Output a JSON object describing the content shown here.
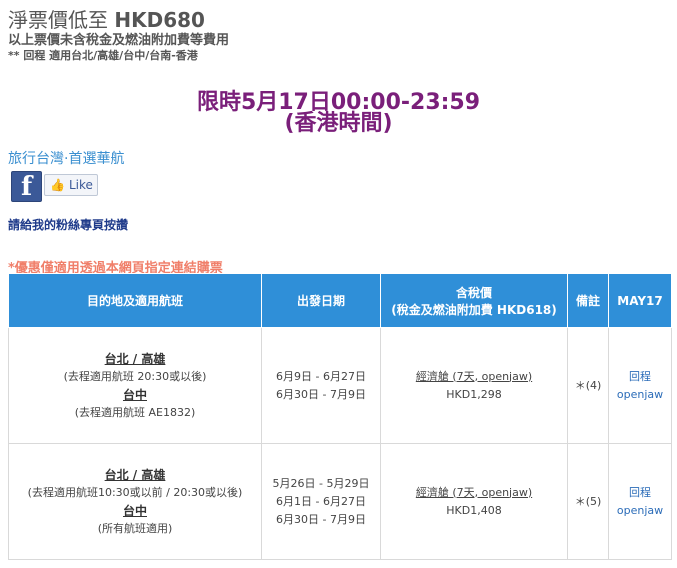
{
  "header": {
    "title_prefix": "淨票價低至 ",
    "title_price": "HKD680",
    "subtitle": "以上票價未含稅金及燃油附加費等費用",
    "note": "** 回程 適用台北/高雄/台中/台南-香港"
  },
  "promo": {
    "line1": "限時5月17日00:00-23:59",
    "line2": "(香港時間)"
  },
  "social": {
    "brand_link": "旅行台灣·首選華航",
    "like_label": "Like",
    "fan_text": "請給我的粉絲專頁按讚"
  },
  "disclaimer": "*優惠僅適用透過本網頁指定連結購票",
  "table": {
    "headers": {
      "destination": "目的地及適用航班",
      "departure": "出發日期",
      "tax_line1": "含稅價",
      "tax_line2": "(稅金及燃油附加費 HKD618)",
      "remarks": "備註",
      "may17": "MAY17"
    },
    "rows": [
      {
        "dest1": "台北 / 高雄",
        "flight1": "(去程適用航班 20:30或以後)",
        "dest2": "台中",
        "flight2": "(去程適用航班 AE1832)",
        "dates": [
          "6月9日 - 6月27日",
          "6月30日 - 7月9日"
        ],
        "cabin": "經濟艙 (7天, openjaw)",
        "price": "HKD1,298",
        "remark": "＊(4)",
        "trip1": "回程",
        "trip2": "openjaw"
      },
      {
        "dest1": "台北 / 高雄",
        "flight1": "(去程適用航班10:30或以前 / 20:30或以後)",
        "dest2": "台中",
        "flight2": "(所有航班適用)",
        "dates": [
          "5月26日 - 5月29日",
          "6月1日 - 6月27日",
          "6月30日 - 7月9日"
        ],
        "cabin": "經濟艙 (7天, openjaw)",
        "price": "HKD1,408",
        "remark": "＊(5)",
        "trip1": "回程",
        "trip2": "openjaw"
      }
    ]
  }
}
